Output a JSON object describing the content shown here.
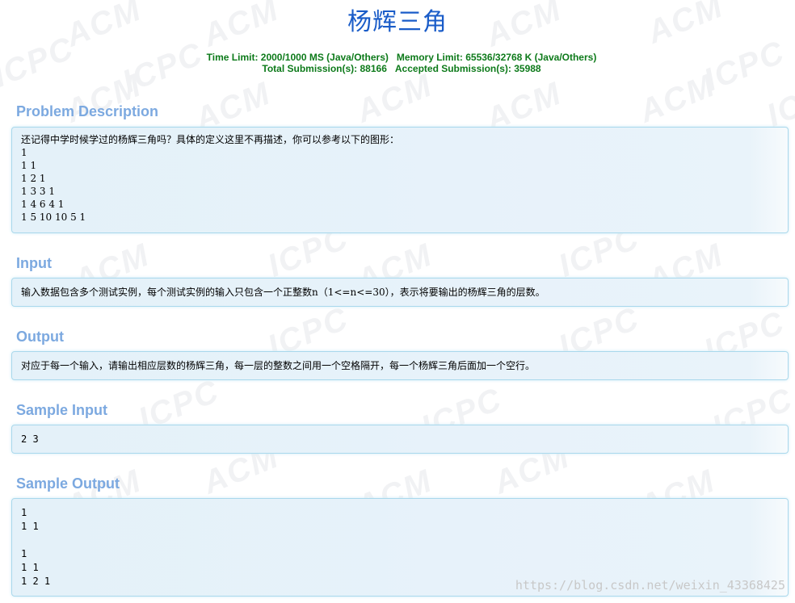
{
  "problem": {
    "title": "杨辉三角",
    "limits_line1": [
      "Time Limit: 2000/1000 MS (Java/Others)",
      "Memory Limit: 65536/32768 K (Java/Others)"
    ],
    "limits_line2": [
      "Total Submission(s): 88166",
      "Accepted Submission(s): 35988"
    ]
  },
  "sections": {
    "description": {
      "heading": "Problem Description",
      "intro": "还记得中学时候学过的杨辉三角吗？具体的定义这里不再描述，你可以参考以下的图形：",
      "lines": [
        "1",
        "1 1",
        "1 2 1",
        "1 3 3 1",
        "1 4 6 4 1",
        "1 5 10 10 5 1"
      ]
    },
    "input": {
      "heading": "Input",
      "text": "输入数据包含多个测试实例，每个测试实例的输入只包含一个正整数n（1<=n<=30），表示将要输出的杨辉三角的层数。"
    },
    "output": {
      "heading": "Output",
      "text": "对应于每一个输入，请输出相应层数的杨辉三角，每一层的整数之间用一个空格隔开，每一个杨辉三角后面加一个空行。"
    },
    "sample_input": {
      "heading": "Sample Input",
      "text": "2 3"
    },
    "sample_output": {
      "heading": "Sample Output",
      "lines": [
        "1",
        "1 1",
        "",
        "1",
        "1 1",
        "1 2 1"
      ]
    }
  },
  "watermark": {
    "url": "https://blog.csdn.net/weixin_43368425"
  }
}
